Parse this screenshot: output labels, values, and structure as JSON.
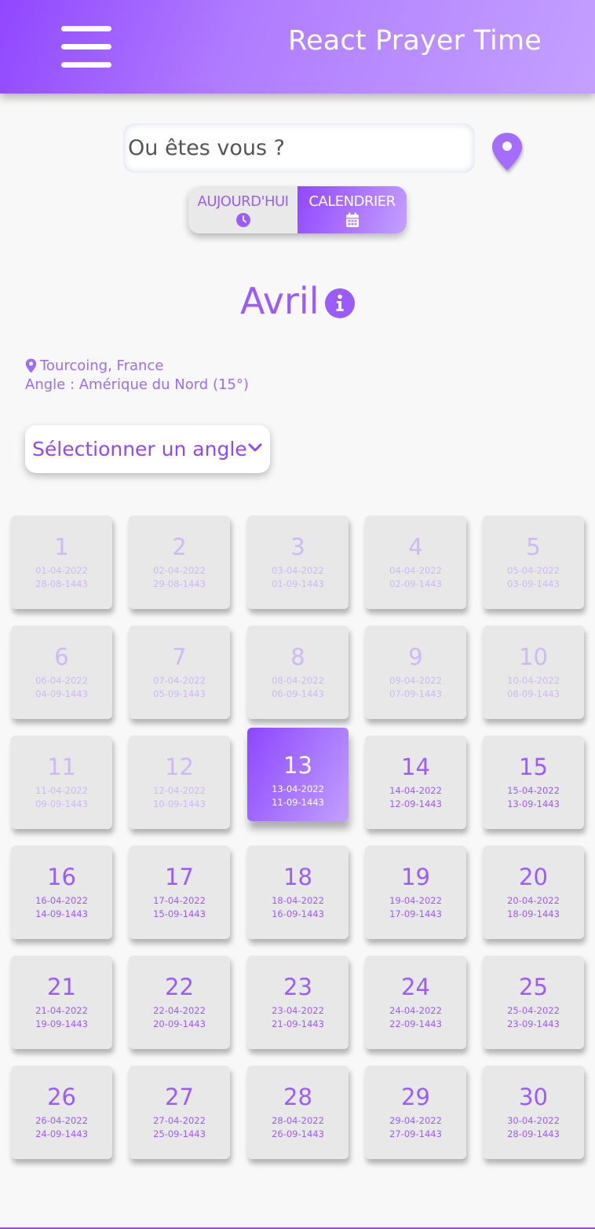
{
  "header": {
    "title": "React Prayer Time",
    "menu_icon": "hamburger-menu-icon",
    "gradient": [
      "#9147ff",
      "#c4a0ff"
    ]
  },
  "search": {
    "placeholder": "Ou êtes vous ?",
    "value": "",
    "location_icon": "map-pin-icon"
  },
  "mode_toggle": {
    "today_label": "AUJOURD'HUI",
    "today_icon": "clock-icon",
    "calendar_label": "CALENDRIER",
    "calendar_icon": "calendar-icon",
    "active": "calendar"
  },
  "calendar": {
    "month": "Avril",
    "info_icon": "info-icon",
    "location": "Tourcoing, France",
    "angle": "Angle : Amérique du Nord (15°)",
    "angle_select_label": "Sélectionner un angle",
    "accent_color": "#9a5cff",
    "today_day": 13,
    "days": [
      {
        "day": "1",
        "greg": "01-04-2022",
        "hijri": "28-08-1443",
        "state": "past"
      },
      {
        "day": "2",
        "greg": "02-04-2022",
        "hijri": "29-08-1443",
        "state": "past"
      },
      {
        "day": "3",
        "greg": "03-04-2022",
        "hijri": "01-09-1443",
        "state": "past"
      },
      {
        "day": "4",
        "greg": "04-04-2022",
        "hijri": "02-09-1443",
        "state": "past"
      },
      {
        "day": "5",
        "greg": "05-04-2022",
        "hijri": "03-09-1443",
        "state": "past"
      },
      {
        "day": "6",
        "greg": "06-04-2022",
        "hijri": "04-09-1443",
        "state": "past"
      },
      {
        "day": "7",
        "greg": "07-04-2022",
        "hijri": "05-09-1443",
        "state": "past"
      },
      {
        "day": "8",
        "greg": "08-04-2022",
        "hijri": "06-09-1443",
        "state": "past"
      },
      {
        "day": "9",
        "greg": "09-04-2022",
        "hijri": "07-09-1443",
        "state": "past"
      },
      {
        "day": "10",
        "greg": "10-04-2022",
        "hijri": "08-09-1443",
        "state": "past"
      },
      {
        "day": "11",
        "greg": "11-04-2022",
        "hijri": "09-09-1443",
        "state": "past"
      },
      {
        "day": "12",
        "greg": "12-04-2022",
        "hijri": "10-09-1443",
        "state": "past"
      },
      {
        "day": "13",
        "greg": "13-04-2022",
        "hijri": "11-09-1443",
        "state": "today"
      },
      {
        "day": "14",
        "greg": "14-04-2022",
        "hijri": "12-09-1443",
        "state": "future"
      },
      {
        "day": "15",
        "greg": "15-04-2022",
        "hijri": "13-09-1443",
        "state": "future"
      },
      {
        "day": "16",
        "greg": "16-04-2022",
        "hijri": "14-09-1443",
        "state": "future"
      },
      {
        "day": "17",
        "greg": "17-04-2022",
        "hijri": "15-09-1443",
        "state": "future"
      },
      {
        "day": "18",
        "greg": "18-04-2022",
        "hijri": "16-09-1443",
        "state": "future"
      },
      {
        "day": "19",
        "greg": "19-04-2022",
        "hijri": "17-09-1443",
        "state": "future"
      },
      {
        "day": "20",
        "greg": "20-04-2022",
        "hijri": "18-09-1443",
        "state": "future"
      },
      {
        "day": "21",
        "greg": "21-04-2022",
        "hijri": "19-09-1443",
        "state": "future"
      },
      {
        "day": "22",
        "greg": "22-04-2022",
        "hijri": "20-09-1443",
        "state": "future"
      },
      {
        "day": "23",
        "greg": "23-04-2022",
        "hijri": "21-09-1443",
        "state": "future"
      },
      {
        "day": "24",
        "greg": "24-04-2022",
        "hijri": "22-09-1443",
        "state": "future"
      },
      {
        "day": "25",
        "greg": "25-04-2022",
        "hijri": "23-09-1443",
        "state": "future"
      },
      {
        "day": "26",
        "greg": "26-04-2022",
        "hijri": "24-09-1443",
        "state": "future"
      },
      {
        "day": "27",
        "greg": "27-04-2022",
        "hijri": "25-09-1443",
        "state": "future"
      },
      {
        "day": "28",
        "greg": "28-04-2022",
        "hijri": "26-09-1443",
        "state": "future"
      },
      {
        "day": "29",
        "greg": "29-04-2022",
        "hijri": "27-09-1443",
        "state": "future"
      },
      {
        "day": "30",
        "greg": "30-04-2022",
        "hijri": "28-09-1443",
        "state": "future"
      }
    ]
  }
}
